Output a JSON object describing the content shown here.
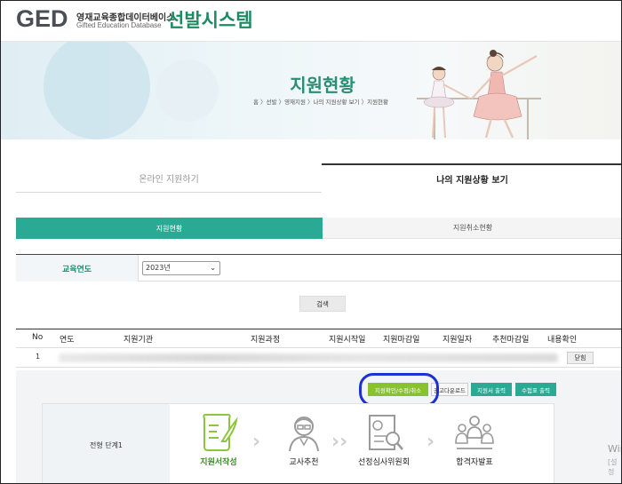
{
  "header": {
    "logo_mark": "GED",
    "logo_korean": "영재교육종합데이터베이스",
    "logo_english": "Gifted Education Database",
    "system_title": "선발시스템"
  },
  "banner": {
    "title": "지원현황",
    "breadcrumb": "홈 〉선발 〉영재지원 〉나의 지원상황 보기 〉지원현황"
  },
  "tabs": [
    {
      "label": "온라인 지원하기",
      "active": false
    },
    {
      "label": "나의 지원상황 보기",
      "active": true
    }
  ],
  "subtabs": [
    {
      "label": "지원현황",
      "active": true
    },
    {
      "label": "지원취소현황",
      "active": false
    }
  ],
  "filter": {
    "label": "교육연도",
    "selected": "2023년"
  },
  "search_label": "검색",
  "table": {
    "columns": [
      "No",
      "연도",
      "지원기관",
      "지원과정",
      "지원시작일",
      "지원마감일",
      "지원일자",
      "추천마감일",
      "내용확인"
    ],
    "rows": [
      {
        "no": "1",
        "action": "닫힘"
      }
    ]
  },
  "actions": {
    "confirm": "지원확인/수정/취소",
    "download": "공고다운로드",
    "print_application": "지원서 출력",
    "print_exam": "수험표 출력"
  },
  "stage": {
    "label": "전형 단계1",
    "steps": [
      "지원서작성",
      "교사추천",
      "선정심사위원회",
      "합격자발표"
    ]
  },
  "watermark": {
    "line1": "Win",
    "line2": "[설정"
  },
  "colors": {
    "brand_green": "#1c8a63",
    "teal": "#2aa995",
    "lime": "#88c22e",
    "highlight_blue": "#1d2fd6"
  }
}
